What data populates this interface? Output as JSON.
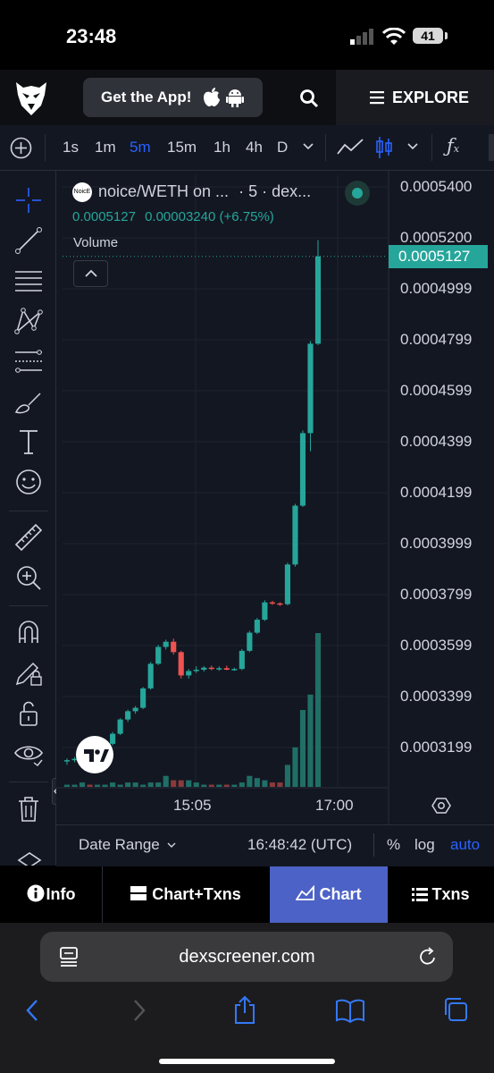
{
  "status_bar": {
    "time": "23:48",
    "battery": "41"
  },
  "header": {
    "get_app_label": "Get the App!",
    "explore_label": "EXPLORE"
  },
  "toolbar": {
    "timeframes": [
      "1s",
      "1m",
      "5m",
      "15m",
      "1h",
      "4h",
      "D"
    ],
    "active_timeframe": "5m"
  },
  "legend": {
    "title": "noice/WETH on ...",
    "interval": "· 5 · dex...",
    "token_logo_text": "NoicE",
    "last_price": "0.0005127",
    "change": "0.00003240 (+6.75%)",
    "volume_label": "Volume"
  },
  "price_axis": {
    "labels": [
      "0.0005400",
      "0.0005200",
      "0.0004999",
      "0.0004799",
      "0.0004599",
      "0.0004399",
      "0.0004199",
      "0.0003999",
      "0.0003799",
      "0.0003599",
      "0.0003399",
      "0.0003199"
    ],
    "current_price": "0.0005127"
  },
  "time_axis": {
    "labels": [
      "15:05",
      "17:00"
    ]
  },
  "bottom_bar": {
    "date_range": "Date Range",
    "clock": "16:48:42 (UTC)",
    "percent": "%",
    "log": "log",
    "auto": "auto"
  },
  "tabs": [
    {
      "label": "Info"
    },
    {
      "label": "Chart+Txns"
    },
    {
      "label": "Chart"
    },
    {
      "label": "Txns"
    }
  ],
  "active_tab": "Chart",
  "browser": {
    "url": "dexscreener.com"
  },
  "colors": {
    "up": "#26a69a",
    "down": "#ef5350",
    "accent": "#2962ff",
    "tab_active": "#4c62c7"
  },
  "chart_data": {
    "type": "candlestick",
    "pair": "noice/WETH",
    "interval": "5m",
    "ylim": [
      0.000308,
      0.000544
    ],
    "candles": [
      {
        "o": 0.000318,
        "h": 0.000319,
        "l": 0.0003165,
        "c": 0.0003183
      },
      {
        "o": 0.0003183,
        "h": 0.0003195,
        "l": 0.0003175,
        "c": 0.0003188
      },
      {
        "o": 0.0003188,
        "h": 0.0003225,
        "l": 0.000318,
        "c": 0.000321
      },
      {
        "o": 0.000321,
        "h": 0.0003222,
        "l": 0.0003196,
        "c": 0.00032
      },
      {
        "o": 0.00032,
        "h": 0.0003232,
        "l": 0.0003195,
        "c": 0.0003226
      },
      {
        "o": 0.0003226,
        "h": 0.0003252,
        "l": 0.000322,
        "c": 0.0003246
      },
      {
        "o": 0.0003246,
        "h": 0.0003292,
        "l": 0.000324,
        "c": 0.0003285
      },
      {
        "o": 0.0003285,
        "h": 0.0003345,
        "l": 0.000328,
        "c": 0.000334
      },
      {
        "o": 0.000334,
        "h": 0.0003378,
        "l": 0.000333,
        "c": 0.0003372
      },
      {
        "o": 0.0003372,
        "h": 0.0003392,
        "l": 0.0003362,
        "c": 0.0003385
      },
      {
        "o": 0.0003385,
        "h": 0.0003465,
        "l": 0.000338,
        "c": 0.000346
      },
      {
        "o": 0.000346,
        "h": 0.0003562,
        "l": 0.0003455,
        "c": 0.0003555
      },
      {
        "o": 0.0003555,
        "h": 0.0003628,
        "l": 0.000355,
        "c": 0.000362
      },
      {
        "o": 0.000362,
        "h": 0.0003648,
        "l": 0.000361,
        "c": 0.000364
      },
      {
        "o": 0.000364,
        "h": 0.0003652,
        "l": 0.000359,
        "c": 0.00036
      },
      {
        "o": 0.00036,
        "h": 0.0003605,
        "l": 0.0003498,
        "c": 0.000351
      },
      {
        "o": 0.000351,
        "h": 0.0003535,
        "l": 0.0003498,
        "c": 0.0003527
      },
      {
        "o": 0.0003527,
        "h": 0.0003545,
        "l": 0.000352,
        "c": 0.0003532
      },
      {
        "o": 0.0003532,
        "h": 0.0003546,
        "l": 0.0003525,
        "c": 0.000354
      },
      {
        "o": 0.000354,
        "h": 0.0003548,
        "l": 0.000353,
        "c": 0.0003535
      },
      {
        "o": 0.0003535,
        "h": 0.0003545,
        "l": 0.0003528,
        "c": 0.0003538
      },
      {
        "o": 0.0003538,
        "h": 0.0003548,
        "l": 0.000353,
        "c": 0.0003532
      },
      {
        "o": 0.0003532,
        "h": 0.000354,
        "l": 0.0003528,
        "c": 0.0003535
      },
      {
        "o": 0.0003535,
        "h": 0.0003612,
        "l": 0.000353,
        "c": 0.0003605
      },
      {
        "o": 0.0003605,
        "h": 0.0003682,
        "l": 0.00036,
        "c": 0.0003675
      },
      {
        "o": 0.0003675,
        "h": 0.0003732,
        "l": 0.000367,
        "c": 0.0003725
      },
      {
        "o": 0.0003725,
        "h": 0.00038,
        "l": 0.000372,
        "c": 0.0003792
      },
      {
        "o": 0.0003792,
        "h": 0.0003798,
        "l": 0.0003782,
        "c": 0.0003788
      },
      {
        "o": 0.0003788,
        "h": 0.0003792,
        "l": 0.0003778,
        "c": 0.0003785
      },
      {
        "o": 0.0003785,
        "h": 0.0003945,
        "l": 0.000378,
        "c": 0.0003938
      },
      {
        "o": 0.0003938,
        "h": 0.0004172,
        "l": 0.000393,
        "c": 0.0004165
      },
      {
        "o": 0.0004165,
        "h": 0.0004455,
        "l": 0.000416,
        "c": 0.0004445
      },
      {
        "o": 0.0004445,
        "h": 0.00048,
        "l": 0.0004375,
        "c": 0.000479
      },
      {
        "o": 0.000479,
        "h": 0.000519,
        "l": 0.0004785,
        "c": 0.0005127
      }
    ],
    "volume": [
      1,
      1,
      2,
      1,
      1,
      1,
      2,
      1,
      2,
      2,
      1,
      2,
      2,
      5,
      3,
      3,
      3,
      2,
      1,
      1,
      1,
      1,
      1,
      2,
      5,
      4,
      3,
      2,
      2,
      10,
      18,
      35,
      42,
      70
    ],
    "volume_colors": [
      "up",
      "up",
      "up",
      "down",
      "up",
      "up",
      "up",
      "up",
      "up",
      "up",
      "up",
      "up",
      "up",
      "up",
      "down",
      "down",
      "up",
      "up",
      "up",
      "down",
      "up",
      "down",
      "up",
      "up",
      "up",
      "up",
      "up",
      "down",
      "down",
      "up",
      "up",
      "up",
      "up",
      "up"
    ]
  }
}
